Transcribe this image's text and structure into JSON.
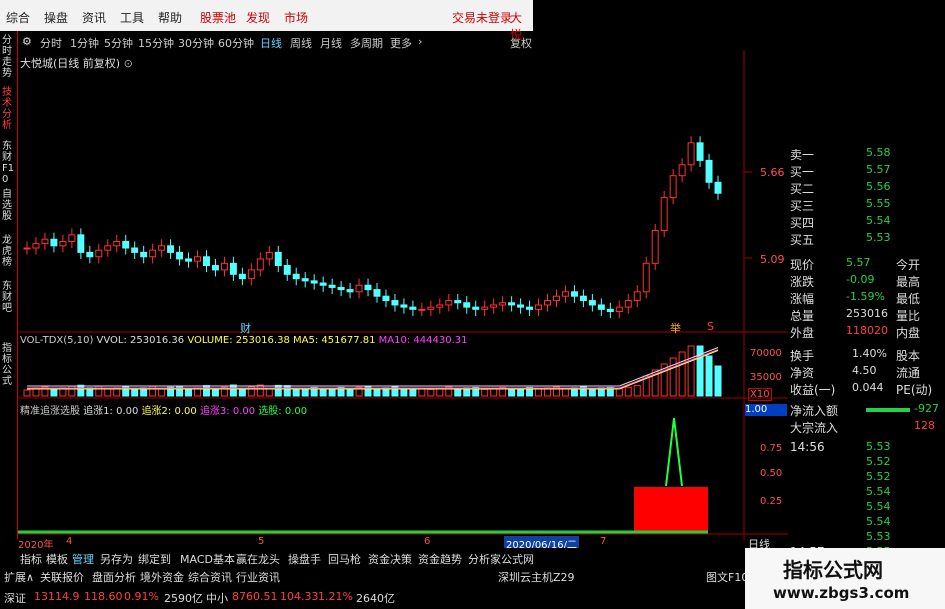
{
  "menu": {
    "items": [
      "综合",
      "操盘",
      "资讯",
      "工具",
      "帮助"
    ],
    "tabs": [
      "股票池",
      "发现",
      "市场"
    ],
    "right1": "交易未登录",
    "right2": "大悦"
  },
  "left_tabs": [
    "分时走势",
    "技术分析",
    "东财F10",
    "自选股",
    "龙虎榜",
    "东财吧",
    "指标公式"
  ],
  "periods": [
    "分时",
    "1分钟",
    "5分钟",
    "15分钟",
    "30分钟",
    "60分钟",
    "日线",
    "周线",
    "月线",
    "多周期",
    "更多"
  ],
  "restore_label": "复权",
  "stock_title": "大悦城(日线 前复权)",
  "price_axis": [
    "5.66",
    "5.09"
  ],
  "markers": {
    "cai": "财",
    "ju": "举",
    "s": "S"
  },
  "vol": {
    "title": "VOL-TDX(5,10)",
    "vvol": "VVOL: 253016.36",
    "volume": "VOLUME: 253016.38",
    "ma5": "MA5: 451677.81",
    "ma10": "MA10: 444430.31",
    "axis": [
      "70000",
      "35000"
    ],
    "x10": "X10"
  },
  "ind": {
    "title": "精准追涨选股",
    "z1": "追涨1: 0.00",
    "z2": "追涨2: 0.00",
    "z3": "追涨3: 0.00",
    "xg": "选股: 0.00",
    "axis": [
      "1.00",
      "0.75",
      "0.50",
      "0.25"
    ],
    "box": "1.00"
  },
  "dates": {
    "d2020": "2020年",
    "m4": "4",
    "m5": "5",
    "m6": "6",
    "cursor": "2020/06/16/二",
    "m7": "7"
  },
  "chart_data": {
    "type": "candlestick",
    "title": "大悦城(日线 前复权)",
    "ylim": [
      4.7,
      5.95
    ],
    "labels": [
      "5.66",
      "5.09"
    ]
  },
  "right": {
    "rows": [
      {
        "l": "卖一",
        "v": "5.58"
      },
      {
        "l": "买一",
        "v": "5.57"
      },
      {
        "l": "买二",
        "v": "5.56"
      },
      {
        "l": "买三",
        "v": "5.55"
      },
      {
        "l": "买四",
        "v": "5.54"
      },
      {
        "l": "买五",
        "v": "5.53"
      }
    ],
    "quote": [
      {
        "l": "现价",
        "v": "5.57",
        "r": "今开"
      },
      {
        "l": "涨跌",
        "v": "-0.09",
        "r": "最高"
      },
      {
        "l": "涨幅",
        "v": "-1.59%",
        "r": "最低"
      },
      {
        "l": "总量",
        "v": "253016",
        "r": "量比"
      },
      {
        "l": "外盘",
        "v": "118020",
        "r": "内盘"
      }
    ],
    "stats": [
      {
        "l": "换手",
        "v": "1.40%",
        "r": "股本"
      },
      {
        "l": "净资",
        "v": "4.50",
        "r": "流通"
      },
      {
        "l": "收益(一)",
        "v": "0.044",
        "r": "PE(动)"
      }
    ],
    "flow": [
      {
        "l": "净流入额",
        "v": "-927"
      },
      {
        "l": "大宗流入",
        "v": "128"
      }
    ],
    "ticks": [
      {
        "t": "14:56",
        "v": "5.53"
      },
      {
        "t": "",
        "v": "5.52"
      },
      {
        "t": "",
        "v": "5.52"
      },
      {
        "t": "",
        "v": "5.54"
      },
      {
        "t": "",
        "v": "5.54"
      },
      {
        "t": "",
        "v": "5.54"
      },
      {
        "t": "",
        "v": "5.53"
      },
      {
        "t": "14:57",
        "v": "5.55"
      }
    ],
    "rixian": "日线"
  },
  "bottom1": [
    "指标",
    "模板",
    "管理",
    "另存为",
    "绑定到",
    "MACD基本",
    "赢在龙头",
    "操盘手",
    "回马枪",
    "资金决策",
    "资金趋势",
    "分析家公式网"
  ],
  "bottom2": [
    "扩展∧",
    "关联报价",
    "盘面分析",
    "境外资金",
    "综合资讯",
    "行业资讯",
    "深圳云主机Z29",
    "图文F10"
  ],
  "status": {
    "idx": "深证",
    "v1": "13114.9",
    "v2": "118.60",
    "v3": "0.91%",
    "amt": "2590亿",
    "mid": "中小",
    "m1": "8760.51",
    "m2": "104.33",
    "m3": "1.21%",
    "amt2": "2640亿"
  },
  "logo": {
    "cn": "指标公式网",
    "url": "www.zbgs3.com"
  }
}
